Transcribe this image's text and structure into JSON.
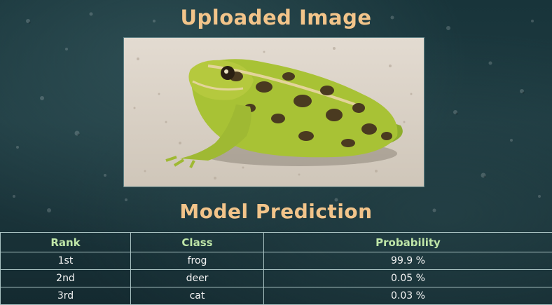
{
  "page": {
    "uploaded_title": "Uploaded Image",
    "prediction_title": "Model Prediction"
  },
  "image": {
    "subject": "frog",
    "alt": "Uploaded Image"
  },
  "table": {
    "headers": [
      "Rank",
      "Class",
      "Probability"
    ],
    "rows": [
      {
        "rank": "1st",
        "class": "frog",
        "probability": "99.9 %"
      },
      {
        "rank": "2nd",
        "class": "deer",
        "probability": "0.05 %"
      },
      {
        "rank": "3rd",
        "class": "cat",
        "probability": "0.03 %"
      }
    ]
  },
  "colors": {
    "heading": "#f2c48a",
    "header_text": "#bfe6a8",
    "cell_text": "#f3f3f3",
    "border": "#a9c2c2"
  }
}
